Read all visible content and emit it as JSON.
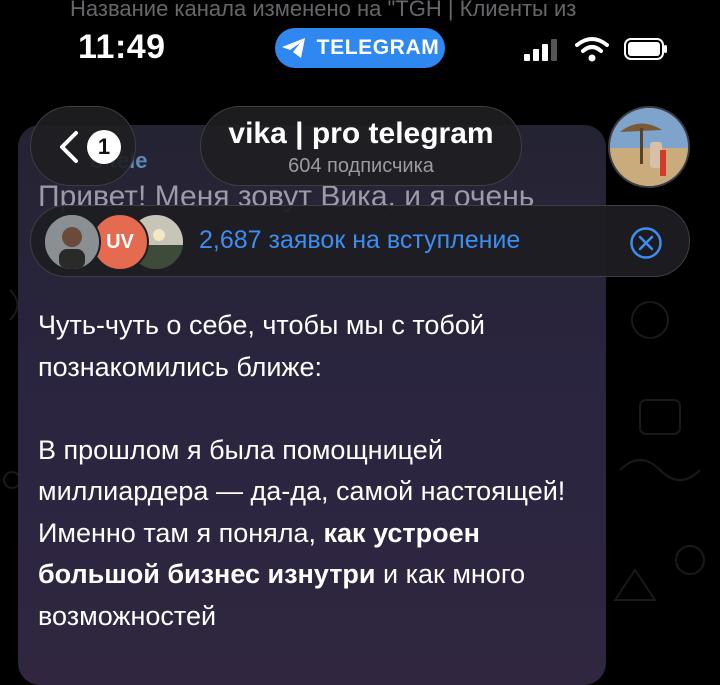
{
  "system_banner": "Название канала изменено на \"TGH | Клиенты из",
  "status_bar": {
    "time": "11:49",
    "app_pill": "TELEGRAM"
  },
  "header": {
    "back": {
      "unread_count": "1"
    },
    "channel_title": "vika | pro telegram",
    "subscribers": "604 подписчика"
  },
  "pinned_message": {
    "sender": "o tele",
    "heading": "Привет! Меня зовут Вика, и я очень"
  },
  "join_requests": {
    "avatar_initials": "UV",
    "text": "2,687 заявок на вступление"
  },
  "message": {
    "p1": "Чуть-чуть о себе, чтобы мы с тобой познакомились ближе:",
    "p2_start": "В прошлом я была помощницей миллиардера — да-да, самой настоящей! Именно там я поняла, ",
    "p2_bold": "как устроен большой бизнес изнутри",
    "p2_end": " и как много возможностей"
  },
  "colors": {
    "accent_blue": "#3d8ef2",
    "pill_blue": "#2f88f0",
    "badge_orange": "#e46a50",
    "bubble_top": "#242332",
    "bubble_bottom": "#30263f"
  },
  "icons": [
    "telegram-plane-icon",
    "cellular-signal-icon",
    "wifi-icon",
    "battery-icon",
    "back-chevron-icon",
    "close-circle-icon"
  ]
}
